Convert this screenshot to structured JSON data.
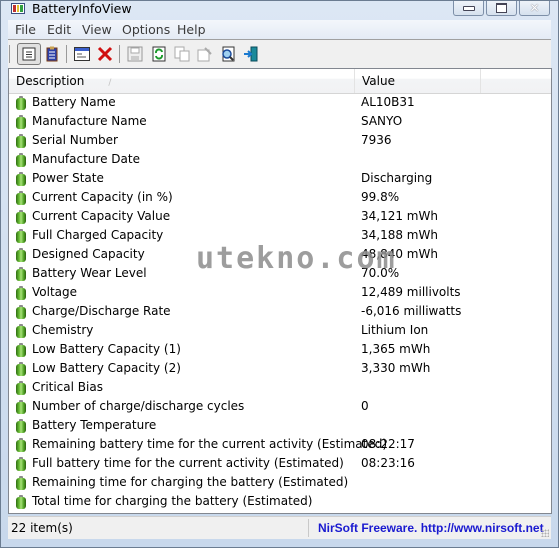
{
  "window": {
    "title": "BatteryInfoView",
    "controls": {
      "minimize": "minimize",
      "maximize": "maximize",
      "close": "close"
    }
  },
  "menu": [
    "File",
    "Edit",
    "View",
    "Options",
    "Help"
  ],
  "toolbar": {
    "buttons": [
      {
        "name": "advanced-mode-icon",
        "active": true
      },
      {
        "name": "battery-log-icon"
      },
      {
        "name": "properties-icon"
      },
      {
        "name": "delete-icon"
      },
      {
        "name": "save-icon",
        "disabled": true
      },
      {
        "name": "refresh-icon"
      },
      {
        "name": "copy-icon",
        "disabled": true
      },
      {
        "name": "html-report-icon",
        "disabled": true
      },
      {
        "name": "find-icon"
      },
      {
        "name": "exit-icon"
      }
    ]
  },
  "list": {
    "columns": [
      "Description",
      "Value"
    ],
    "rows": [
      {
        "description": "Battery Name",
        "value": "AL10B31"
      },
      {
        "description": "Manufacture Name",
        "value": "SANYO"
      },
      {
        "description": "Serial Number",
        "value": "7936"
      },
      {
        "description": "Manufacture Date",
        "value": ""
      },
      {
        "description": "Power State",
        "value": "Discharging"
      },
      {
        "description": "Current Capacity (in %)",
        "value": "99.8%"
      },
      {
        "description": "Current Capacity Value",
        "value": "34,121 mWh"
      },
      {
        "description": "Full Charged Capacity",
        "value": "34,188 mWh"
      },
      {
        "description": "Designed Capacity",
        "value": "48,840 mWh"
      },
      {
        "description": "Battery Wear Level",
        "value": "70.0%"
      },
      {
        "description": "Voltage",
        "value": "12,489 millivolts"
      },
      {
        "description": "Charge/Discharge Rate",
        "value": "-6,016 milliwatts"
      },
      {
        "description": "Chemistry",
        "value": "Lithium Ion"
      },
      {
        "description": "Low Battery Capacity (1)",
        "value": "1,365 mWh"
      },
      {
        "description": "Low Battery Capacity (2)",
        "value": "3,330 mWh"
      },
      {
        "description": "Critical Bias",
        "value": ""
      },
      {
        "description": "Number of charge/discharge cycles",
        "value": "0"
      },
      {
        "description": "Battery Temperature",
        "value": ""
      },
      {
        "description": "Remaining battery time for the current activity (Estimated)",
        "value": "08:22:17"
      },
      {
        "description": "Full battery time for the current activity (Estimated)",
        "value": "08:23:16"
      },
      {
        "description": "Remaining time for charging the battery (Estimated)",
        "value": ""
      },
      {
        "description": "Total  time for charging the battery (Estimated)",
        "value": ""
      }
    ]
  },
  "watermark": "utekno.com",
  "status": {
    "count": "22 item(s)",
    "link": "NirSoft Freeware.  http://www.nirsoft.net"
  },
  "colors": {
    "link": "#1a1ad0",
    "battery": "#56a829"
  }
}
